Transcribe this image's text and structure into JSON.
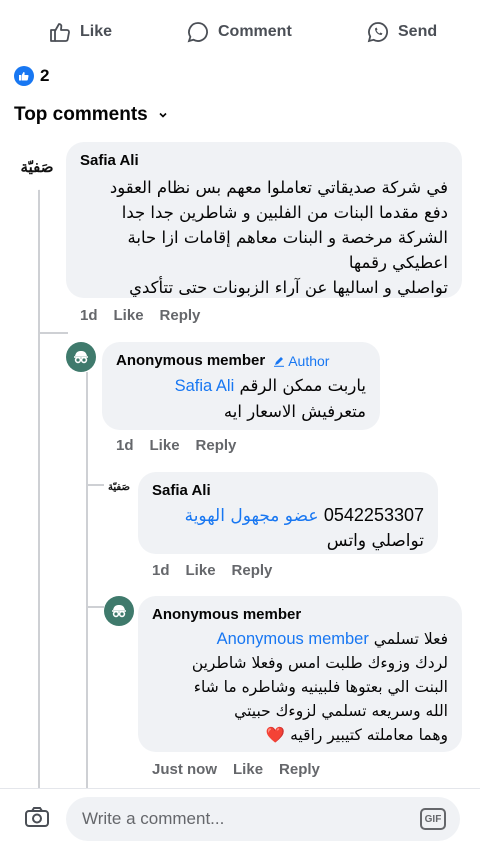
{
  "actions": {
    "like": "Like",
    "comment": "Comment",
    "send": "Send"
  },
  "reactions": {
    "count": "2"
  },
  "sort": {
    "label": "Top comments"
  },
  "comments": [
    {
      "author": "Safia Ali",
      "avatar_text": "صَفيّة",
      "lines": [
        "في شركة صديقاتي تعاملوا معهم بس نظام العقود",
        "دفع مقدما البنات من الفلبين و شاطرين جدا جدا",
        "الشركة مرخصة و البنات معاهم إقامات ازا حابة",
        "اعطيكي رقمها",
        "تواصلي و اساليها عن آراء الزبونات حتى تتأكدي"
      ],
      "time": "1d",
      "like": "Like",
      "reply": "Reply"
    },
    {
      "author": "Anonymous member",
      "badge": "Author",
      "mention": "Safia Ali",
      "line1_rest": "ياربت ممكن الرقم",
      "line2": "متعرفيش الاسعار ايه",
      "time": "1d",
      "like": "Like",
      "reply": "Reply"
    },
    {
      "author": "Safia Ali",
      "avatar_text": "صَفيّة",
      "line1_number": "0542253307",
      "mention": "عضو مجهول الهوية",
      "line2": "تواصلي واتس",
      "time": "1d",
      "like": "Like",
      "reply": "Reply"
    },
    {
      "author": "Anonymous member",
      "mention": "Anonymous member",
      "line1_rest": "فعلا تسلمي",
      "lines": [
        "لردك وزوءك  طلبت امس وفعلا شاطرين",
        "البنت الي بعتوها فلبينيه وشاطره ما شاء",
        "الله وسريعه  تسلمي لزوءك حبيتي"
      ],
      "last_line": "وهما معاملته كتيبير راقيه",
      "heart": "❤️",
      "time": "Just now",
      "like": "Like",
      "reply": "Reply"
    }
  ],
  "composer": {
    "placeholder": "Write a comment...",
    "gif": "GIF"
  }
}
